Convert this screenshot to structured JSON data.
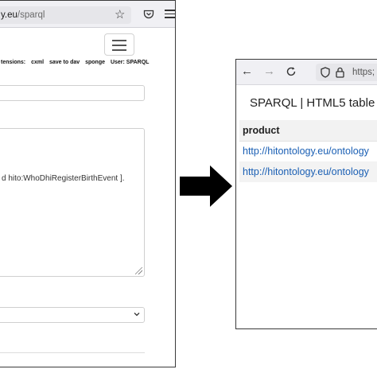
{
  "left_window": {
    "url_domain": "y.eu",
    "url_path": "/sparql",
    "nav_items": [
      "tensions:",
      "cxml",
      "save to dav",
      "sponge",
      "User: SPARQL"
    ],
    "query_text_fragment": "d hito:WhoDhiRegisterBirthEvent ]."
  },
  "right_window": {
    "url_text": "https;",
    "page_title": "SPARQL | HTML5 table",
    "table": {
      "header": "product",
      "rows": [
        "http://hitontology.eu/ontology",
        "http://hitontology.eu/ontology"
      ]
    }
  },
  "icons": {
    "left": [
      "star-icon",
      "pocket-icon",
      "menu-icon",
      "hamburger-icon",
      "chevron-down-icon",
      "resize-handle-icon"
    ],
    "right": [
      "back-arrow-icon",
      "forward-arrow-icon",
      "reload-icon",
      "shield-icon",
      "lock-icon"
    ],
    "between": "right-arrow-icon"
  },
  "colors": {
    "link": "#1a5fb4",
    "arrow": "#000000",
    "browser_chrome": "#f0f0f4"
  }
}
